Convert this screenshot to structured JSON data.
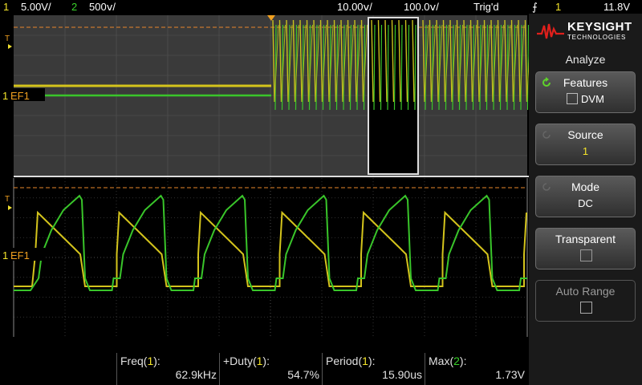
{
  "topbar": {
    "ch1_num": "1",
    "ch1_scale": "5.00V/",
    "ch2_num": "2",
    "ch2_scale": "500ⅴ/",
    "time_scale": "10.00ⅴ/",
    "time_delay": "100.0ⅴ/",
    "trig_status": "Trig'd",
    "trig_source": "1",
    "trig_level": "11.8V"
  },
  "logo": {
    "brand": "KEYSIGHT",
    "sub": "TECHNOLOGIES"
  },
  "menu": {
    "title": "Analyze",
    "softkeys": [
      {
        "label": "Features",
        "value": "DVM",
        "value_checkbox": true,
        "enabled": true
      },
      {
        "label": "Source",
        "value": "1",
        "enabled": true
      },
      {
        "label": "Mode",
        "value": "DC",
        "enabled": true
      },
      {
        "label": "Transparent",
        "value": "",
        "checkbox": true,
        "enabled": true
      },
      {
        "label": "Auto Range",
        "value": "",
        "checkbox": true,
        "enabled": false
      }
    ]
  },
  "scope": {
    "ch1_marker": "1",
    "filter_label": "EF1",
    "trig_marker": "T",
    "colors": {
      "ch1": "#d4c41c",
      "ch2": "#39c52a",
      "grid": "#4a4a4a",
      "trig_line": "#e8872a"
    }
  },
  "measurements": [
    {
      "label": "Freq(",
      "src": "1",
      "label_end": "):",
      "value": "62.9kHz"
    },
    {
      "label": "+Duty(",
      "src": "1",
      "label_end": "):",
      "value": "54.7%"
    },
    {
      "label": "Period(",
      "src": "1",
      "label_end": "):",
      "value": "15.90us"
    },
    {
      "label": "Max(",
      "src": "2",
      "label_end": "):",
      "value": "1.73V"
    }
  ]
}
